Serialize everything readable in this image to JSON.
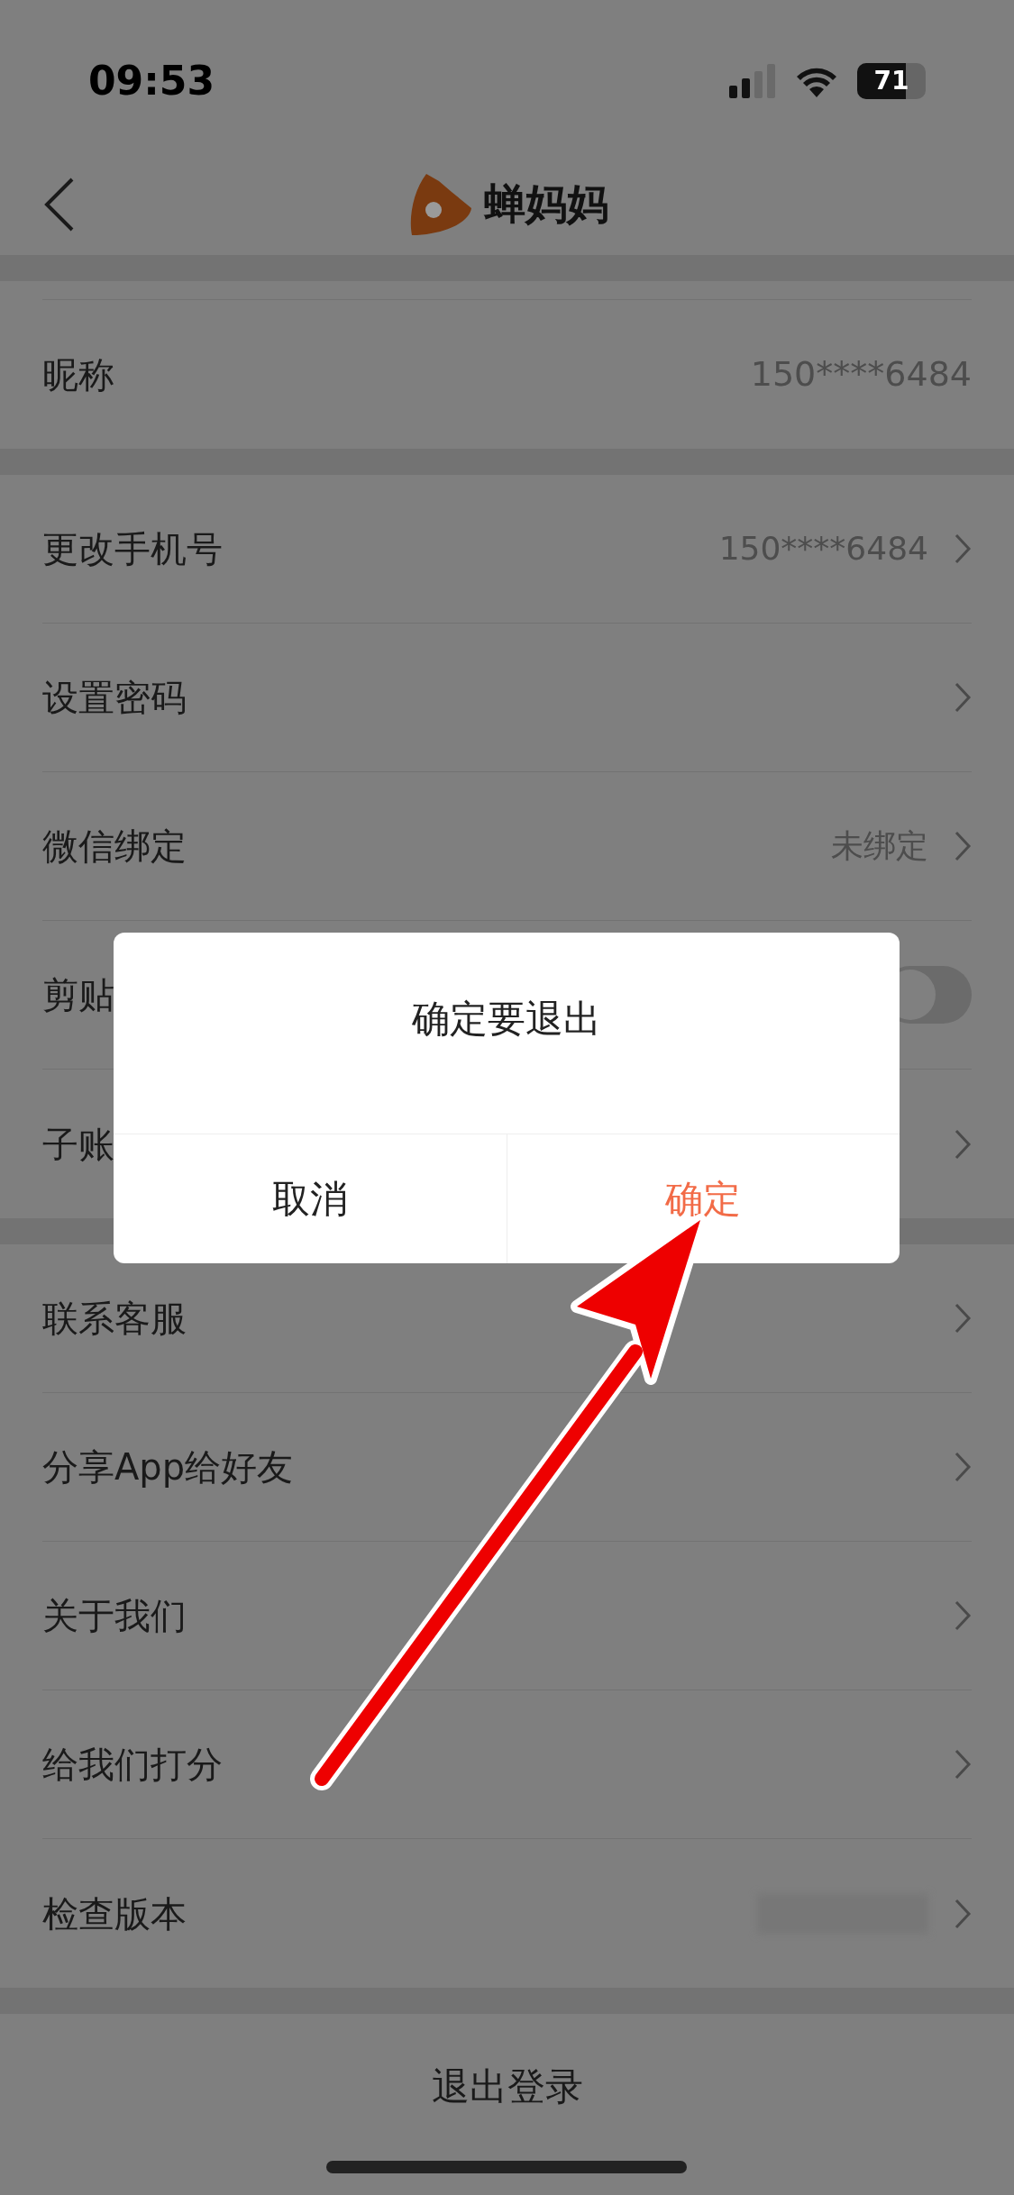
{
  "status_bar": {
    "time": "09:53",
    "battery": "71"
  },
  "header": {
    "logo_text": "蝉妈妈"
  },
  "sections": [
    [
      {
        "kind": "text",
        "label": "昵称",
        "value": "150****6484"
      }
    ],
    [
      {
        "kind": "link",
        "label": "更改手机号",
        "value": "150****6484"
      },
      {
        "kind": "link",
        "label": "设置密码"
      },
      {
        "kind": "link",
        "label": "微信绑定",
        "value": "未绑定"
      },
      {
        "kind": "toggle",
        "label": "剪贴",
        "on": false
      },
      {
        "kind": "link",
        "label": "子账"
      }
    ],
    [
      {
        "kind": "link",
        "label": "联系客服"
      },
      {
        "kind": "link",
        "label": "分享App给好友"
      },
      {
        "kind": "link",
        "label": "关于我们"
      },
      {
        "kind": "link",
        "label": "给我们打分"
      },
      {
        "kind": "blurred",
        "label": "检查版本"
      }
    ]
  ],
  "logout": {
    "label": "退出登录"
  },
  "dialog": {
    "title": "确定要退出",
    "buttons": [
      {
        "kind": "cancel",
        "label": "取消"
      },
      {
        "kind": "confirm",
        "label": "确定"
      }
    ]
  }
}
